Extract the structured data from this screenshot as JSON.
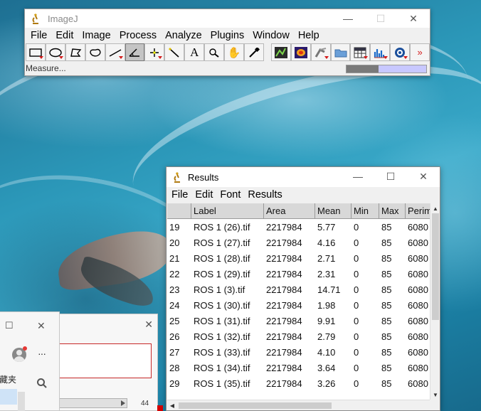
{
  "imagej": {
    "title": "ImageJ",
    "window_controls": [
      "—",
      "☐",
      "✕"
    ],
    "menus": [
      "File",
      "Edit",
      "Image",
      "Process",
      "Analyze",
      "Plugins",
      "Window",
      "Help"
    ],
    "tools": [
      {
        "name": "rectangle-tool-icon",
        "glyph": "▭"
      },
      {
        "name": "oval-tool-icon",
        "glyph": "◯"
      },
      {
        "name": "polygon-tool-icon",
        "glyph": "⬠"
      },
      {
        "name": "freehand-tool-icon",
        "glyph": "◌"
      },
      {
        "name": "line-tool-icon",
        "glyph": "╱"
      },
      {
        "name": "angle-tool-icon",
        "glyph": "∠"
      },
      {
        "name": "point-tool-icon",
        "glyph": "✛"
      },
      {
        "name": "wand-tool-icon",
        "glyph": "⟋"
      },
      {
        "name": "text-tool-icon",
        "glyph": "A"
      },
      {
        "name": "magnifier-tool-icon",
        "glyph": "⚲"
      },
      {
        "name": "hand-tool-icon",
        "glyph": "✋"
      },
      {
        "name": "dropper-tool-icon",
        "glyph": "✎"
      }
    ],
    "extra_tools": [
      {
        "name": "developer-menu-icon"
      },
      {
        "name": "lut-menu-icon"
      },
      {
        "name": "stack-tools-icon"
      },
      {
        "name": "open-folder-icon"
      },
      {
        "name": "table-tools-icon"
      },
      {
        "name": "histogram-tools-icon"
      },
      {
        "name": "update-tools-icon"
      }
    ],
    "more_tools": "»",
    "status": "Measure...",
    "progress": 0.4
  },
  "results": {
    "title": "Results",
    "window_controls": [
      "—",
      "☐",
      "✕"
    ],
    "menus": [
      "File",
      "Edit",
      "Font",
      "Results"
    ],
    "columns": [
      "",
      "Label",
      "Area",
      "Mean",
      "Min",
      "Max",
      "Perim"
    ],
    "rows": [
      [
        "19",
        "ROS 1 (26).tif",
        "2217984",
        "5.77",
        "0",
        "85",
        "6080"
      ],
      [
        "20",
        "ROS 1 (27).tif",
        "2217984",
        "4.16",
        "0",
        "85",
        "6080"
      ],
      [
        "21",
        "ROS 1 (28).tif",
        "2217984",
        "2.71",
        "0",
        "85",
        "6080"
      ],
      [
        "22",
        "ROS 1 (29).tif",
        "2217984",
        "2.31",
        "0",
        "85",
        "6080"
      ],
      [
        "23",
        "ROS 1 (3).tif",
        "2217984",
        "14.71",
        "0",
        "85",
        "6080"
      ],
      [
        "24",
        "ROS 1 (30).tif",
        "2217984",
        "1.98",
        "0",
        "85",
        "6080"
      ],
      [
        "25",
        "ROS 1 (31).tif",
        "2217984",
        "9.91",
        "0",
        "85",
        "6080"
      ],
      [
        "26",
        "ROS 1 (32).tif",
        "2217984",
        "2.79",
        "0",
        "85",
        "6080"
      ],
      [
        "27",
        "ROS 1 (33).tif",
        "2217984",
        "4.10",
        "0",
        "85",
        "6080"
      ],
      [
        "28",
        "ROS 1 (34).tif",
        "2217984",
        "3.64",
        "0",
        "85",
        "6080"
      ],
      [
        "29",
        "ROS 1 (35).tif",
        "2217984",
        "3.26",
        "0",
        "85",
        "6080"
      ]
    ]
  },
  "background_window": {
    "controls": [
      "☐",
      "✕"
    ],
    "close": "✕",
    "more": "···",
    "folder_label": "藏夹",
    "count": "44"
  }
}
